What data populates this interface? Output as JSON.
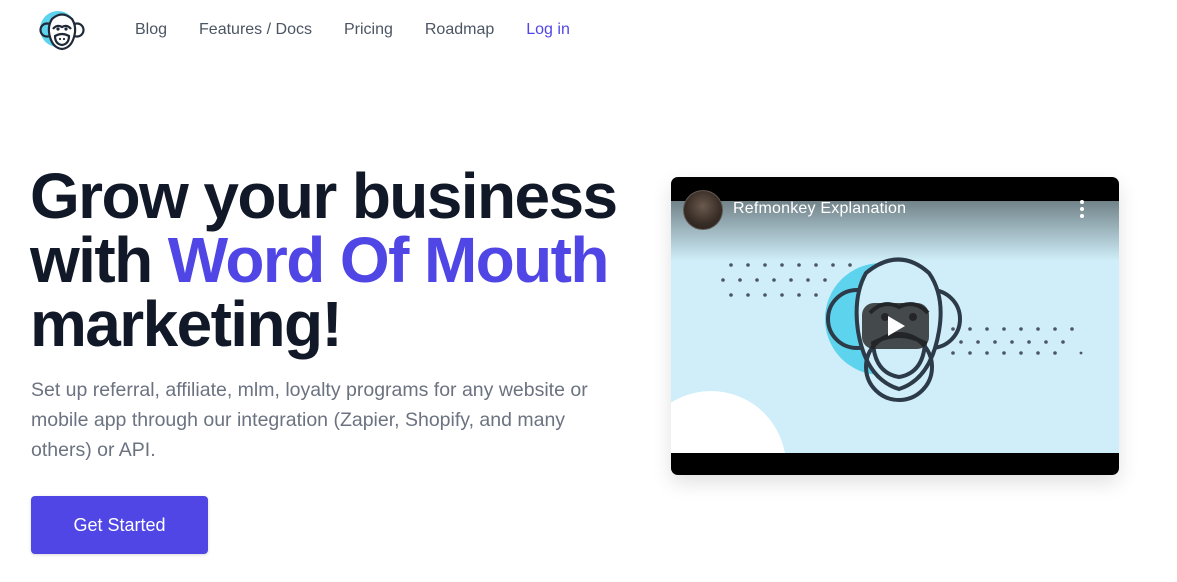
{
  "nav": {
    "logo_icon": "monkey-logo-icon",
    "links": [
      {
        "label": "Blog"
      },
      {
        "label": "Features / Docs"
      },
      {
        "label": "Pricing"
      },
      {
        "label": "Roadmap"
      },
      {
        "label": "Log in"
      }
    ]
  },
  "hero": {
    "title_line1": "Grow your business",
    "title_line2_prefix": "with ",
    "title_line2_accent": "Word Of Mouth",
    "title_line3": "marketing!",
    "subtitle": "Set up referral, affiliate, mlm, loyalty programs for any website or mobile app through our integration (Zapier, Shopify, and many others) or API.",
    "cta_label": "Get Started"
  },
  "video": {
    "title": "Refmonkey Explanation",
    "play_icon": "play-icon",
    "menu_icon": "more-vertical-icon"
  },
  "colors": {
    "accent": "#4f46e5",
    "text_dark": "#111827",
    "text_muted": "#6b7280",
    "video_bg": "#cfeef9",
    "logo_cyan": "#5ed3ee"
  }
}
